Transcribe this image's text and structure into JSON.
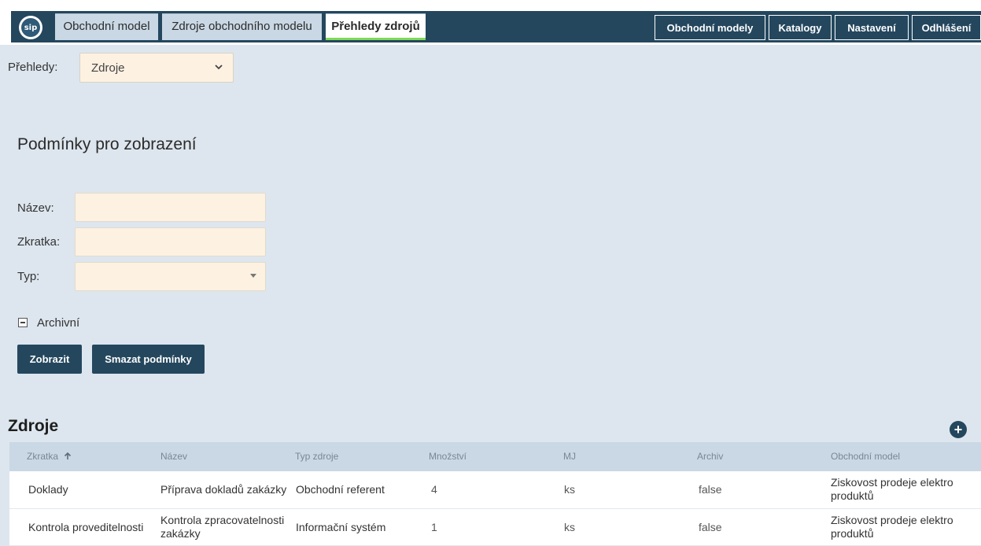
{
  "nav": {
    "logo_text": "sip",
    "tabs": [
      {
        "label": "Obchodní model"
      },
      {
        "label": "Zdroje obchodního modelu"
      },
      {
        "label": "Přehledy zdrojů"
      }
    ],
    "right_buttons": [
      {
        "label": "Obchodní modely"
      },
      {
        "label": "Katalogy"
      },
      {
        "label": "Nastavení"
      },
      {
        "label": "Odhlášení"
      }
    ]
  },
  "overview": {
    "label": "Přehledy:",
    "selected": "Zdroje"
  },
  "conditions": {
    "title": "Podmínky pro zobrazení",
    "name_label": "Název:",
    "name_value": "",
    "abbr_label": "Zkratka:",
    "abbr_value": "",
    "type_label": "Typ:",
    "type_value": "",
    "archive_label": "Archivní",
    "show_button": "Zobrazit",
    "clear_button": "Smazat podmínky"
  },
  "table": {
    "title": "Zdroje",
    "add_icon": "plus-icon",
    "sort_icon": "arrow-up-icon",
    "headers": [
      "Zkratka",
      "Název",
      "Typ zdroje",
      "Množství",
      "MJ",
      "Archiv",
      "Obchodní model"
    ],
    "rows": [
      {
        "zkratka": "Doklady",
        "nazev": "Příprava dokladů zakázky",
        "typ": "Obchodní referent",
        "mnozstvi": "4",
        "mj": "ks",
        "archiv": "false",
        "model": "Ziskovost prodeje elektro produktů"
      },
      {
        "zkratka": "Kontrola proveditelnosti",
        "nazev": "Kontrola zpracovatelnosti zakázky",
        "typ": "Informační systém",
        "mnozstvi": "1",
        "mj": "ks",
        "archiv": "false",
        "model": "Ziskovost prodeje elektro produktů"
      }
    ]
  },
  "colors": {
    "navbar": "#24475e",
    "tab": "#c9d8e4",
    "active_tab_underline": "#7ed957",
    "background": "#dde6ee",
    "input_bg": "#fdf1e2"
  }
}
